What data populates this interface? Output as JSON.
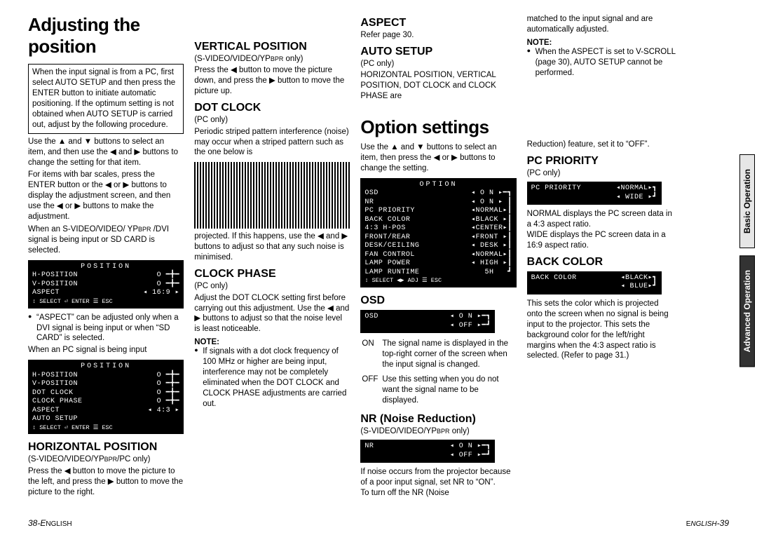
{
  "title1": "Adjusting the position",
  "intro_box": "When the input signal is from a PC, first select AUTO SETUP and then press the ENTER button to initiate automatic positioning. If the optimum setting is not obtained when AUTO SETUP is carried out, adjust by the following procedure.",
  "intro_text1": "Use the ▲ and ▼ buttons to select an item, and then use the ◀ and ▶ buttons to change the setting for that item.",
  "intro_text2": "For items with bar scales, press the ENTER button or the ◀ or ▶ buttons to display the adjustment screen, and then use the ◀ or ▶ buttons to make the adjustment.",
  "intro_text3_a": "When an S-VIDEO/VIDEO/ YP",
  "intro_text3_b": " /DVI signal is being input or SD CARD is selected.",
  "osd1": {
    "title": "POSITION",
    "r1": [
      "H-POSITION",
      "O"
    ],
    "r2": [
      "V-POSITION",
      "O"
    ],
    "r3": [
      "ASPECT",
      "16:9"
    ],
    "foot": "↕ SELECT ⏎ ENTER   ☰ ESC"
  },
  "aspect_note": "“ASPECT” can be adjusted only when a DVI signal is being input or when “SD CARD” is selected.",
  "intro_text4": "When an PC signal is being input",
  "osd2": {
    "title": "POSITION",
    "r1": [
      "H-POSITION",
      "O"
    ],
    "r2": [
      "V-POSITION",
      "O"
    ],
    "r3": [
      "DOT CLOCK",
      "O"
    ],
    "r4": [
      "CLOCK PHASE",
      "O"
    ],
    "r5": [
      "ASPECT",
      "4:3"
    ],
    "r6": [
      "AUTO SETUP",
      ""
    ],
    "foot": "↕ SELECT ⏎ ENTER   ☰ ESC"
  },
  "hpos": {
    "h": "HORIZONTAL POSITION",
    "sub_a": "(S-VIDEO/VIDEO/YP",
    "sub_b": "/PC only)",
    "body": "Press the ◀ button to move the picture to the left, and press the ▶ button to move the picture to the right."
  },
  "vpos": {
    "h": "VERTICAL POSITION",
    "sub_a": "(S-VIDEO/VIDEO/YP",
    "sub_b": " only)",
    "body": "Press the ◀ button to move the picture down, and press the ▶ button to move the picture up."
  },
  "dotclock": {
    "h": "DOT CLOCK",
    "sub": "(PC only)",
    "body1": "Periodic striped pattern interference (noise) may occur when a striped pattern such as the one below is",
    "body2": "projected. If this happens, use the ◀ and ▶ buttons to adjust so that any such noise is minimised."
  },
  "clockphase": {
    "h": "CLOCK PHASE",
    "sub": "(PC only)",
    "body": "Adjust the DOT CLOCK setting first before carrying out this adjustment. Use the ◀ and ▶ buttons to adjust so that the noise level is least noticeable.",
    "noteh": "NOTE:",
    "note": "If signals with a dot clock frequency of 100 MHz or higher are being input, interference may not be completely eliminated when the DOT CLOCK and CLOCK PHASE adjustments are carried out."
  },
  "aspect": {
    "h": "ASPECT",
    "body": "Refer page 30."
  },
  "autosetup": {
    "h": "AUTO SETUP",
    "sub": "(PC only)",
    "body": "HORIZONTAL POSITION, VERTICAL POSITION, DOT CLOCK and CLOCK PHASE are"
  },
  "title2": "Option settings",
  "opt_intro": "Use the ▲ and ▼ buttons to select an item, then press the ◀ or ▶ buttons to change the setting.",
  "osd3": {
    "title": "OPTION",
    "rows": [
      [
        "OSD",
        "ON"
      ],
      [
        "NR",
        "ON"
      ],
      [
        "PC PRIORITY",
        "NORMAL"
      ],
      [
        "BACK COLOR",
        "BLACK"
      ],
      [
        "4:3 H-POS",
        "CENTER"
      ],
      [
        "FRONT/REAR",
        "FRONT"
      ],
      [
        "DESK/CEILING",
        "DESK"
      ],
      [
        "FAN CONTROL",
        "NORMAL"
      ],
      [
        "LAMP POWER",
        "HIGH"
      ],
      [
        "LAMP RUNTIME",
        "5H"
      ]
    ],
    "foot": "↕ SELECT ◀▶ ADJ    ☰ ESC"
  },
  "osd_h": {
    "h": "OSD"
  },
  "osd4": {
    "r1": [
      "OSD",
      "ON"
    ],
    "r2": [
      "",
      "OFF"
    ]
  },
  "osd_defs": {
    "on_l": "ON",
    "on_t": "The signal name is displayed in the top-right corner of the screen when the input signal is changed.",
    "off_l": "OFF",
    "off_t": "Use this setting when you do not want the signal name to be displayed."
  },
  "nr": {
    "h": "NR (Noise Reduction)",
    "sub_a": "(S-VIDEO/VIDEO/YP",
    "sub_b": " only)",
    "body": "If noise occurs from the projector because of a poor input signal, set NR to “ON”.\nTo turn off the NR (Noise"
  },
  "osd5": {
    "r1": [
      "NR",
      "ON"
    ],
    "r2": [
      "",
      "OFF"
    ]
  },
  "col4top": "matched to the input signal and are automatically adjusted.",
  "noteh2": "NOTE:",
  "note2": "When the ASPECT is set to V-SCROLL (page 30), AUTO SETUP cannot be performed.",
  "nr_tail": "Reduction) feature, set it to “OFF”.",
  "pcpri": {
    "h": "PC PRIORITY",
    "sub": "(PC only)",
    "body": "NORMAL displays the PC screen data in a 4:3 aspect ratio.\nWIDE displays the PC screen data in a 16:9 aspect ratio."
  },
  "osd6": {
    "r1": [
      "PC PRIORITY",
      "NORMAL"
    ],
    "r2": [
      "",
      "WIDE"
    ]
  },
  "backcolor": {
    "h": "BACK COLOR",
    "body": "This sets the color which is projected onto the screen when no signal is being input to the projector. This sets the background color for the left/right margins when the 4:3 aspect ratio is selected. (Refer to page 31.)"
  },
  "osd7": {
    "r1": [
      "BACK COLOR",
      "BLACK"
    ],
    "r2": [
      "",
      "BLUE"
    ]
  },
  "tabs": {
    "basic": "Basic Operation",
    "adv": "Advanced Operation"
  },
  "footer": {
    "left": "38-ENGLISH",
    "right": "ENGLISH-39"
  },
  "smallcaps": {
    "bpr": "BPR",
    "r": "R"
  }
}
